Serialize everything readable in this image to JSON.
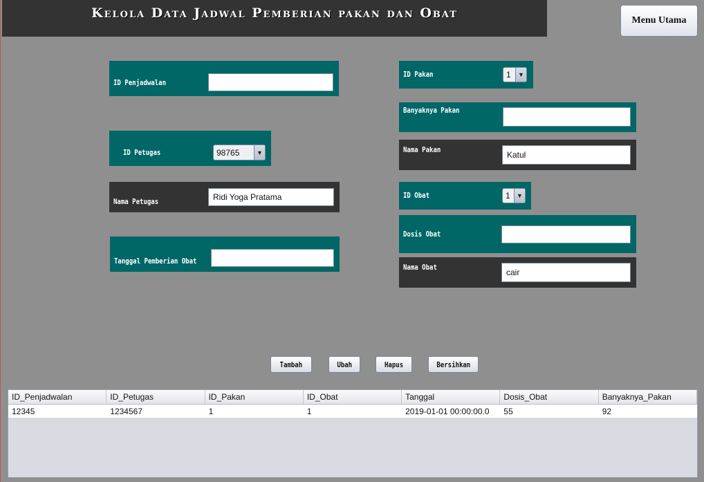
{
  "header": {
    "title": "Kelola Data Jadwal Pemberian pakan dan Obat"
  },
  "menu_button": "Menu Utama",
  "form_left": {
    "id_penjadwalan": {
      "label": "ID Penjadwalan",
      "value": ""
    },
    "id_petugas": {
      "label": "ID Petugas",
      "value": "98765"
    },
    "nama_petugas": {
      "label": "Nama Petugas",
      "value": "Ridi Yoga Pratama"
    },
    "tanggal": {
      "label": "Tanggal Pemberian Obat",
      "value": ""
    }
  },
  "form_right": {
    "id_pakan": {
      "label": "ID Pakan",
      "value": "1"
    },
    "banyaknya_pakan": {
      "label": "Banyaknya Pakan",
      "value": ""
    },
    "nama_pakan": {
      "label": "Nama Pakan",
      "value": "Katul"
    },
    "id_obat": {
      "label": "ID Obat",
      "value": "1"
    },
    "dosis_obat": {
      "label": "Dosis Obat",
      "value": ""
    },
    "nama_obat": {
      "label": "Nama Obat",
      "value": "cair"
    }
  },
  "actions": {
    "tambah": "Tambah",
    "ubah": "Ubah",
    "hapus": "Hapus",
    "bersihkan": "Bersihkan"
  },
  "table": {
    "columns": [
      "ID_Penjadwalan",
      "ID_Petugas",
      "ID_Pakan",
      "ID_Obat",
      "Tanggal",
      "Dosis_Obat",
      "Banyaknya_Pakan"
    ],
    "rows": [
      [
        "12345",
        "1234567",
        "1",
        "1",
        "2019-01-01 00:00:00.0",
        "55",
        "92"
      ]
    ]
  },
  "colors": {
    "teal": "#006666",
    "dark": "#333333",
    "background": "#8f8f8f"
  },
  "icons": {
    "combo_arrow": "chevron-down-icon"
  }
}
